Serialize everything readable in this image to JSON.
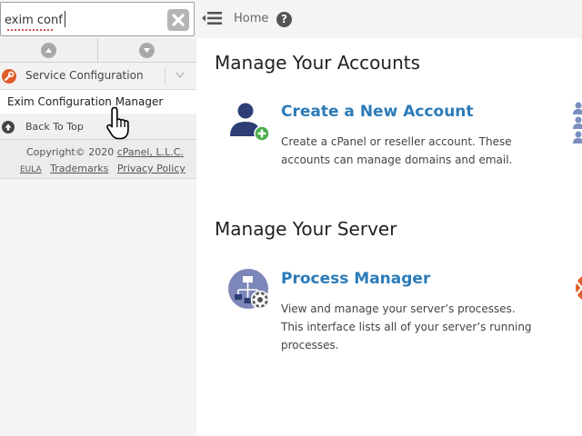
{
  "search": {
    "value": "exim conf",
    "clear_label": "clear search"
  },
  "sidebar": {
    "group_label": "Service Configuration",
    "items": [
      {
        "label": "Exim Configuration Manager"
      }
    ],
    "back_to_top": "Back To Top",
    "footer": {
      "copyright_prefix": "Copyright© 2020 ",
      "company": "cPanel, L.L.C.",
      "links": [
        "EULA",
        "Trademarks",
        "Privacy Policy"
      ]
    }
  },
  "topbar": {
    "home_label": "Home",
    "help_label": "?"
  },
  "main": {
    "sections": [
      {
        "title": "Manage Your Accounts",
        "feature": {
          "title": "Create a New Account",
          "description": "Create a cPanel or reseller account. These accounts can manage domains and email.",
          "icon": "add-user-icon"
        }
      },
      {
        "title": "Manage Your Server",
        "feature": {
          "title": "Process Manager",
          "description": "View and manage your server’s processes. This interface lists all of your server’s running processes.",
          "icon": "process-gear-icon"
        }
      }
    ]
  },
  "colors": {
    "link_blue": "#2b7bb9",
    "sidebar_bg": "#f4f4f4",
    "accent_orange": "#e15c2a",
    "icon_navy": "#2c3e75",
    "add_green": "#4cae4c"
  }
}
